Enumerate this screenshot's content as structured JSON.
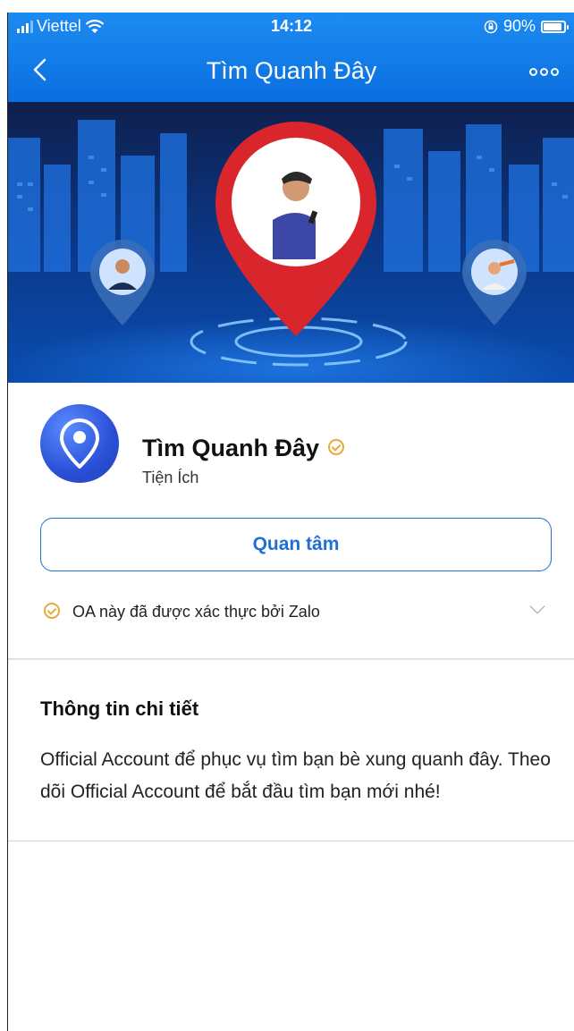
{
  "status_bar": {
    "carrier": "Viettel",
    "time": "14:12",
    "battery": "90%"
  },
  "nav": {
    "title": "Tìm Quanh Đây",
    "back_icon": "chevron-left-icon",
    "more_icon": "more-icon"
  },
  "profile": {
    "name": "Tìm Quanh Đây",
    "category": "Tiện Ích",
    "follow_label": "Quan tâm",
    "verified_text": "OA này đã được xác thực bởi Zalo"
  },
  "details": {
    "title": "Thông tin chi tiết",
    "description": "Official Account để phục vụ tìm bạn bè xung quanh đây. Theo dõi Official Account để bắt đầu tìm bạn mới nhé!"
  },
  "colors": {
    "header_blue": "#0a6fe0",
    "button_blue": "#1f6fd6",
    "verified_gold": "#e8a93a",
    "pin_red": "#d9262c",
    "avatar_blue": "#2a4fd6"
  }
}
